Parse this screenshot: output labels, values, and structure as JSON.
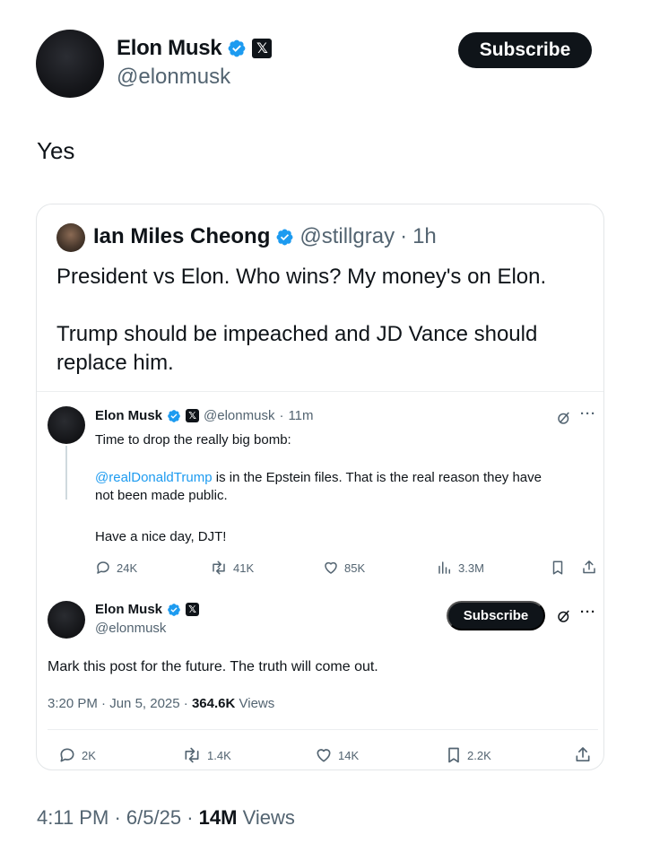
{
  "tweet": {
    "author_name": "Elon Musk",
    "author_handle": "@elonmusk",
    "subscribe_label": "Subscribe",
    "text": "Yes",
    "time": "4:11 PM",
    "date": "6/5/25",
    "views_count": "14M",
    "views_label": "Views"
  },
  "quote": {
    "author_name": "Ian Miles Cheong",
    "author_handle": "@stillgray",
    "age": "1h",
    "line1": "President vs Elon. Who wins? My money's on Elon.",
    "line2": "Trump should be impeached and JD Vance should",
    "line3": "replace him."
  },
  "nested1": {
    "author_name": "Elon Musk",
    "author_handle": "@elonmusk",
    "age": "11m",
    "line1": "Time to drop the really big bomb:",
    "mention": "@realDonaldTrump",
    "line2_rest": " is in the Epstein files. That is the real reason they have",
    "line3": "not been made public.",
    "line4": "Have a nice day, DJT!",
    "replies": "24K",
    "reposts": "41K",
    "likes": "85K",
    "views": "3.3M"
  },
  "nested2": {
    "author_name": "Elon Musk",
    "author_handle": "@elonmusk",
    "subscribe_label": "Subscribe",
    "text": "Mark this post for the future. The truth will come out.",
    "time": "3:20 PM",
    "date": "Jun 5, 2025",
    "views_count": "364.6K",
    "views_label": "Views",
    "replies": "2K",
    "reposts": "1.4K",
    "likes": "14K",
    "bookmarks": "2.2K"
  },
  "colors": {
    "verified": "#1d9bf0",
    "text_primary": "#0f1419",
    "text_secondary": "#536471",
    "link": "#1d9bf0"
  },
  "icons": [
    "verified-badge-icon",
    "x-logo-icon",
    "grok-icon",
    "more-icon",
    "reply-icon",
    "repost-icon",
    "like-icon",
    "views-icon",
    "bookmark-icon",
    "share-icon"
  ]
}
